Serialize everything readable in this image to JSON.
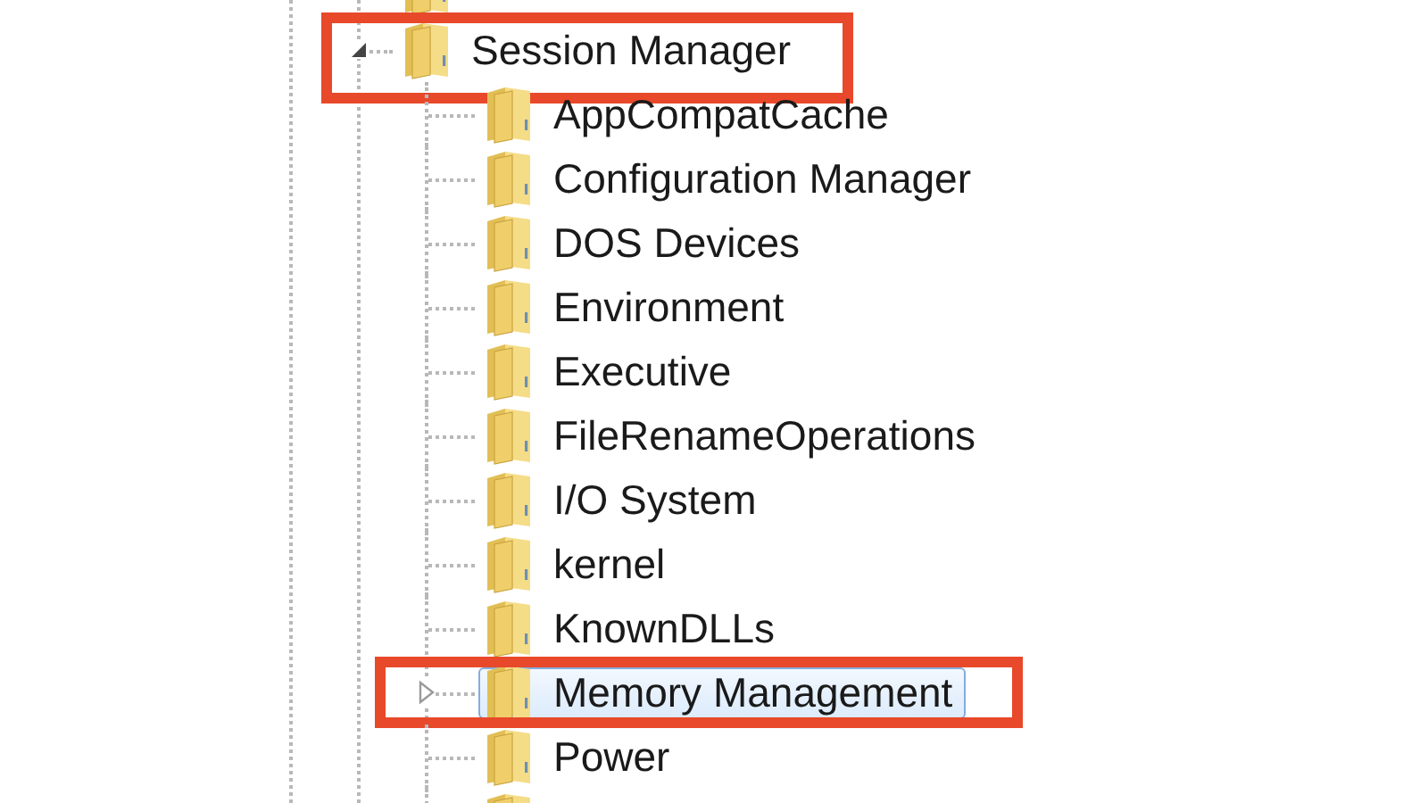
{
  "tree": [
    {
      "selected": false
    },
    {
      "label": "Session Manager",
      "expanded": true,
      "selected": false,
      "highlighted": true,
      "children": [
        {
          "label": "AppCompatCache",
          "expandable": false,
          "selected": false,
          "highlighted": false
        },
        {
          "label": "Configuration Manager",
          "expandable": false,
          "selected": false,
          "highlighted": false
        },
        {
          "label": "DOS Devices",
          "expandable": false,
          "selected": false,
          "highlighted": false
        },
        {
          "label": "Environment",
          "expandable": false,
          "selected": false,
          "highlighted": false
        },
        {
          "label": "Executive",
          "expandable": false,
          "selected": false,
          "highlighted": false
        },
        {
          "label": "FileRenameOperations",
          "expandable": false,
          "selected": false,
          "highlighted": false
        },
        {
          "label": "I/O System",
          "expandable": false,
          "selected": false,
          "highlighted": false
        },
        {
          "label": "kernel",
          "expandable": false,
          "selected": false,
          "highlighted": false
        },
        {
          "label": "KnownDLLs",
          "expandable": false,
          "selected": false,
          "highlighted": false
        },
        {
          "label": "Memory Management",
          "expandable": true,
          "selected": true,
          "highlighted": true
        },
        {
          "label": "Power",
          "expandable": false,
          "selected": false,
          "highlighted": false
        },
        {
          "expandable": false,
          "selected": false
        }
      ]
    }
  ]
}
